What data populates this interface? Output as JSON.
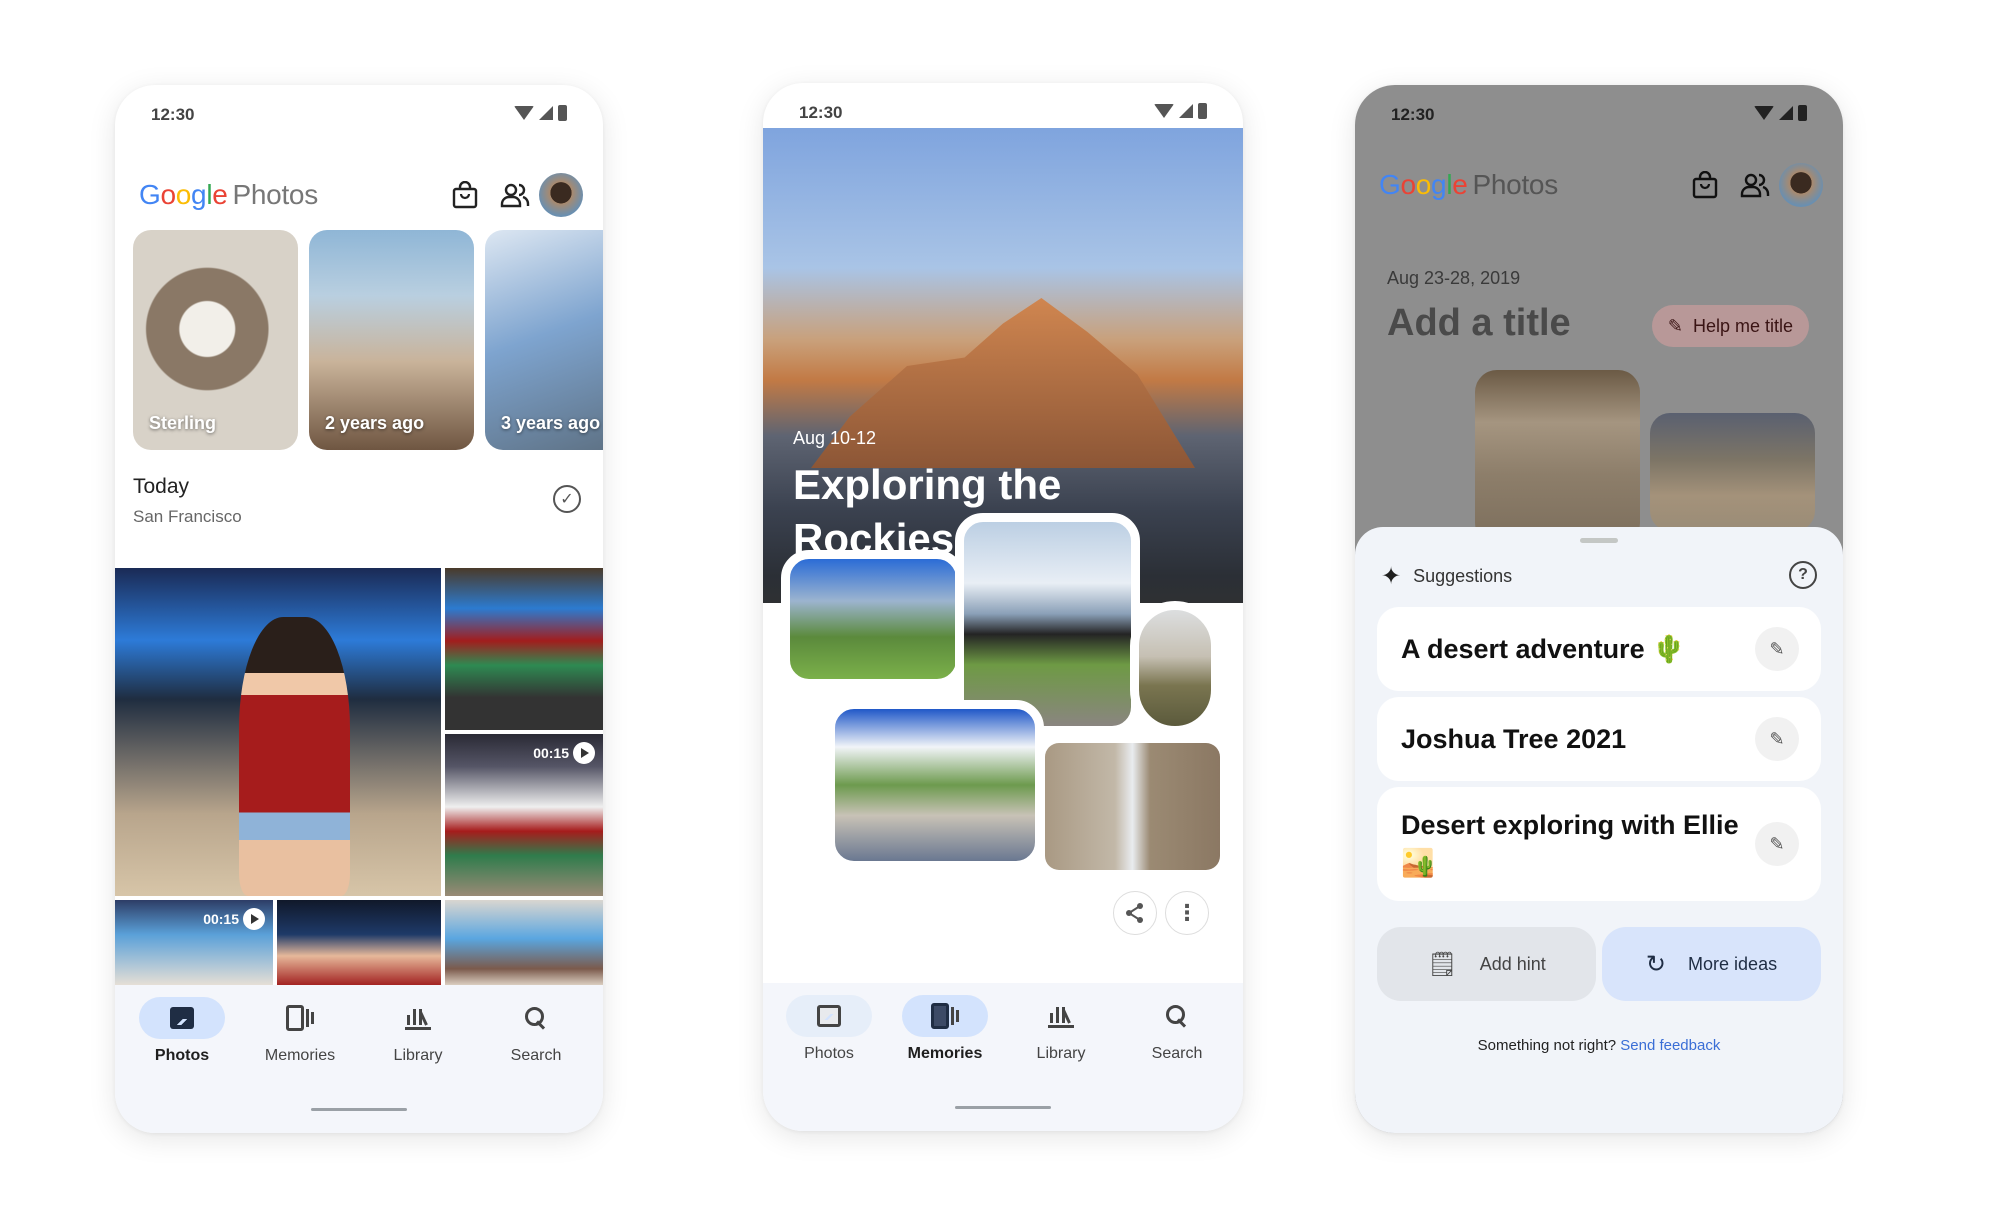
{
  "status_bar": {
    "time": "12:30"
  },
  "app": {
    "logo_google": [
      "G",
      "o",
      "o",
      "g",
      "l",
      "e"
    ],
    "logo_product": "Photos"
  },
  "phone1": {
    "memories": [
      {
        "label": "Sterling"
      },
      {
        "label": "2 years ago"
      },
      {
        "label": "3 years ago"
      }
    ],
    "day_title": "Today",
    "day_location": "San Francisco",
    "videos": [
      {
        "duration": "00:15"
      },
      {
        "duration": "00:15"
      }
    ],
    "nav": [
      {
        "label": "Photos",
        "active": true
      },
      {
        "label": "Memories",
        "active": false
      },
      {
        "label": "Library",
        "active": false
      },
      {
        "label": "Search",
        "active": false
      }
    ]
  },
  "phone2": {
    "memory_date": "Aug 10-12",
    "memory_title": "Exploring the Rockies",
    "nav": [
      {
        "label": "Photos",
        "active": false
      },
      {
        "label": "Memories",
        "active": true
      },
      {
        "label": "Library",
        "active": false
      },
      {
        "label": "Search",
        "active": false
      }
    ]
  },
  "phone3": {
    "date_range": "Aug 23-28, 2019",
    "title_placeholder": "Add a title",
    "help_chip": "Help me title",
    "sheet_title": "Suggestions",
    "suggestions": [
      {
        "text": "A desert adventure 🌵"
      },
      {
        "text": "Joshua Tree 2021"
      },
      {
        "text": "Desert exploring with Ellie 🏜️"
      }
    ],
    "add_hint": "Add hint",
    "more_ideas": "More ideas",
    "feedback_prompt": "Something not right?",
    "feedback_link": "Send feedback"
  },
  "colors": {
    "accent_blue": "#d3e3fd",
    "link_blue": "#3a6ed6",
    "help_chip_bg": "#b89898"
  }
}
